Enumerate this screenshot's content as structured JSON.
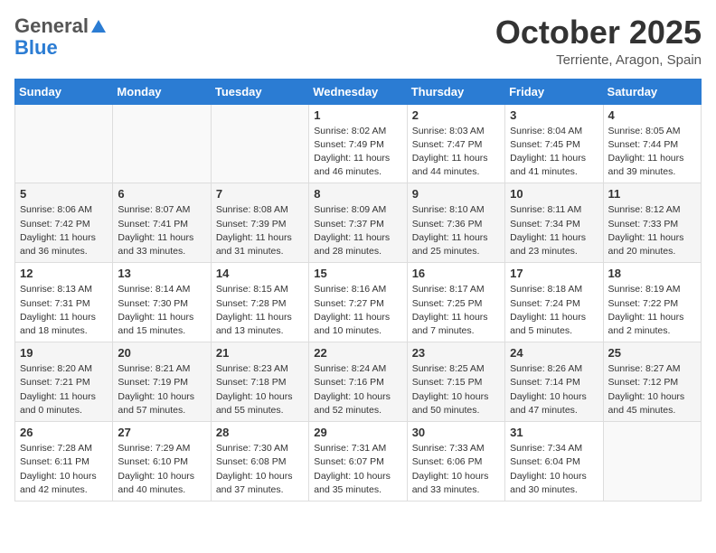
{
  "header": {
    "logo_general": "General",
    "logo_blue": "Blue",
    "month_title": "October 2025",
    "location": "Terriente, Aragon, Spain"
  },
  "weekdays": [
    "Sunday",
    "Monday",
    "Tuesday",
    "Wednesday",
    "Thursday",
    "Friday",
    "Saturday"
  ],
  "weeks": [
    [
      {
        "day": "",
        "info": ""
      },
      {
        "day": "",
        "info": ""
      },
      {
        "day": "",
        "info": ""
      },
      {
        "day": "1",
        "info": "Sunrise: 8:02 AM\nSunset: 7:49 PM\nDaylight: 11 hours\nand 46 minutes."
      },
      {
        "day": "2",
        "info": "Sunrise: 8:03 AM\nSunset: 7:47 PM\nDaylight: 11 hours\nand 44 minutes."
      },
      {
        "day": "3",
        "info": "Sunrise: 8:04 AM\nSunset: 7:45 PM\nDaylight: 11 hours\nand 41 minutes."
      },
      {
        "day": "4",
        "info": "Sunrise: 8:05 AM\nSunset: 7:44 PM\nDaylight: 11 hours\nand 39 minutes."
      }
    ],
    [
      {
        "day": "5",
        "info": "Sunrise: 8:06 AM\nSunset: 7:42 PM\nDaylight: 11 hours\nand 36 minutes."
      },
      {
        "day": "6",
        "info": "Sunrise: 8:07 AM\nSunset: 7:41 PM\nDaylight: 11 hours\nand 33 minutes."
      },
      {
        "day": "7",
        "info": "Sunrise: 8:08 AM\nSunset: 7:39 PM\nDaylight: 11 hours\nand 31 minutes."
      },
      {
        "day": "8",
        "info": "Sunrise: 8:09 AM\nSunset: 7:37 PM\nDaylight: 11 hours\nand 28 minutes."
      },
      {
        "day": "9",
        "info": "Sunrise: 8:10 AM\nSunset: 7:36 PM\nDaylight: 11 hours\nand 25 minutes."
      },
      {
        "day": "10",
        "info": "Sunrise: 8:11 AM\nSunset: 7:34 PM\nDaylight: 11 hours\nand 23 minutes."
      },
      {
        "day": "11",
        "info": "Sunrise: 8:12 AM\nSunset: 7:33 PM\nDaylight: 11 hours\nand 20 minutes."
      }
    ],
    [
      {
        "day": "12",
        "info": "Sunrise: 8:13 AM\nSunset: 7:31 PM\nDaylight: 11 hours\nand 18 minutes."
      },
      {
        "day": "13",
        "info": "Sunrise: 8:14 AM\nSunset: 7:30 PM\nDaylight: 11 hours\nand 15 minutes."
      },
      {
        "day": "14",
        "info": "Sunrise: 8:15 AM\nSunset: 7:28 PM\nDaylight: 11 hours\nand 13 minutes."
      },
      {
        "day": "15",
        "info": "Sunrise: 8:16 AM\nSunset: 7:27 PM\nDaylight: 11 hours\nand 10 minutes."
      },
      {
        "day": "16",
        "info": "Sunrise: 8:17 AM\nSunset: 7:25 PM\nDaylight: 11 hours\nand 7 minutes."
      },
      {
        "day": "17",
        "info": "Sunrise: 8:18 AM\nSunset: 7:24 PM\nDaylight: 11 hours\nand 5 minutes."
      },
      {
        "day": "18",
        "info": "Sunrise: 8:19 AM\nSunset: 7:22 PM\nDaylight: 11 hours\nand 2 minutes."
      }
    ],
    [
      {
        "day": "19",
        "info": "Sunrise: 8:20 AM\nSunset: 7:21 PM\nDaylight: 11 hours\nand 0 minutes."
      },
      {
        "day": "20",
        "info": "Sunrise: 8:21 AM\nSunset: 7:19 PM\nDaylight: 10 hours\nand 57 minutes."
      },
      {
        "day": "21",
        "info": "Sunrise: 8:23 AM\nSunset: 7:18 PM\nDaylight: 10 hours\nand 55 minutes."
      },
      {
        "day": "22",
        "info": "Sunrise: 8:24 AM\nSunset: 7:16 PM\nDaylight: 10 hours\nand 52 minutes."
      },
      {
        "day": "23",
        "info": "Sunrise: 8:25 AM\nSunset: 7:15 PM\nDaylight: 10 hours\nand 50 minutes."
      },
      {
        "day": "24",
        "info": "Sunrise: 8:26 AM\nSunset: 7:14 PM\nDaylight: 10 hours\nand 47 minutes."
      },
      {
        "day": "25",
        "info": "Sunrise: 8:27 AM\nSunset: 7:12 PM\nDaylight: 10 hours\nand 45 minutes."
      }
    ],
    [
      {
        "day": "26",
        "info": "Sunrise: 7:28 AM\nSunset: 6:11 PM\nDaylight: 10 hours\nand 42 minutes."
      },
      {
        "day": "27",
        "info": "Sunrise: 7:29 AM\nSunset: 6:10 PM\nDaylight: 10 hours\nand 40 minutes."
      },
      {
        "day": "28",
        "info": "Sunrise: 7:30 AM\nSunset: 6:08 PM\nDaylight: 10 hours\nand 37 minutes."
      },
      {
        "day": "29",
        "info": "Sunrise: 7:31 AM\nSunset: 6:07 PM\nDaylight: 10 hours\nand 35 minutes."
      },
      {
        "day": "30",
        "info": "Sunrise: 7:33 AM\nSunset: 6:06 PM\nDaylight: 10 hours\nand 33 minutes."
      },
      {
        "day": "31",
        "info": "Sunrise: 7:34 AM\nSunset: 6:04 PM\nDaylight: 10 hours\nand 30 minutes."
      },
      {
        "day": "",
        "info": ""
      }
    ]
  ]
}
